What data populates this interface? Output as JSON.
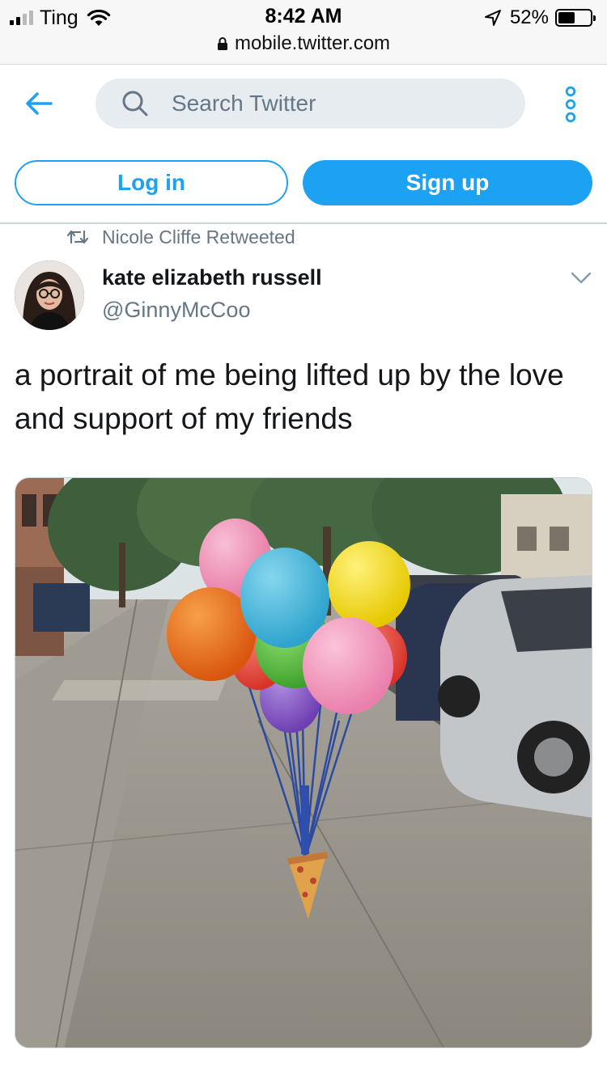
{
  "status_bar": {
    "carrier": "Ting",
    "time": "8:42 AM",
    "battery": "52%",
    "battery_level": 0.52,
    "url": "mobile.twitter.com"
  },
  "header": {
    "search_placeholder": "Search Twitter",
    "login_label": "Log in",
    "signup_label": "Sign up"
  },
  "tweet": {
    "retweeted_by": "Nicole Cliffe Retweeted",
    "author_name": "kate elizabeth russell",
    "author_handle": "@GinnyMcCoo",
    "text": "a portrait of me being lifted up by the love and support of my friends"
  },
  "colors": {
    "brand": "#1da1f2",
    "secondary_text": "#657786",
    "search_bg": "#e6ecf0"
  },
  "icons": [
    "signal-icon",
    "wifi-icon",
    "location-icon",
    "battery-icon",
    "lock-icon",
    "back-arrow-icon",
    "search-icon",
    "more-icon",
    "retweet-icon",
    "caret-down-icon"
  ]
}
